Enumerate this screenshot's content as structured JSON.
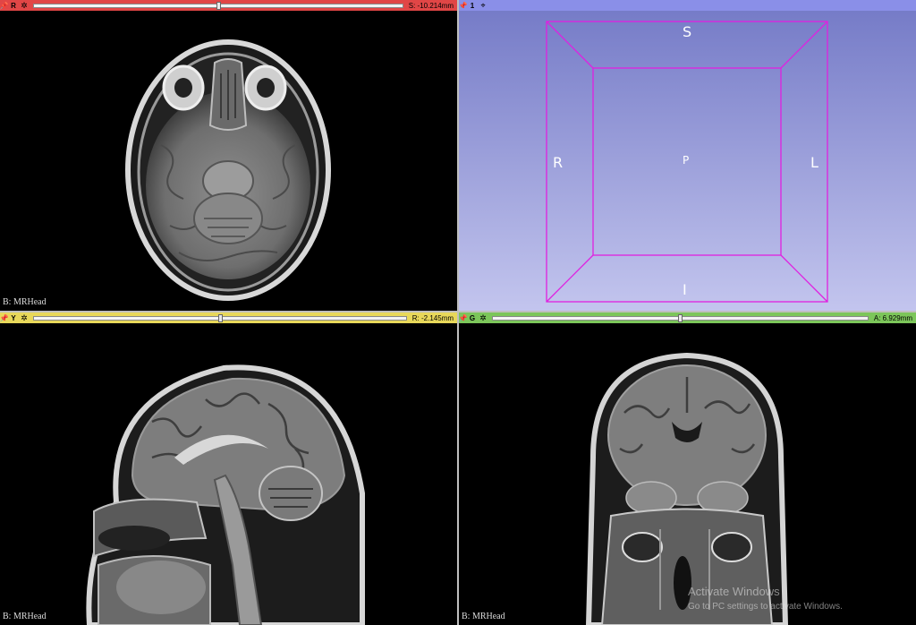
{
  "views": {
    "red": {
      "label": "R",
      "offset_readout": "S: -10.214mm",
      "slice_position": 0.5,
      "volume_label": "B: MRHead",
      "bar_color": "#e14646",
      "icons": [
        "pin-icon",
        "gear-icon"
      ]
    },
    "three_d": {
      "label": "1",
      "bar_color": "#8a8fe8",
      "orientation": {
        "top": "S",
        "bottom": "I",
        "left": "R",
        "right": "L",
        "center": "P"
      },
      "box_color": "#e020e0",
      "icons": [
        "pin-icon",
        "eye-icon"
      ]
    },
    "yellow": {
      "label": "Y",
      "offset_readout": "R: -2.145mm",
      "slice_position": 0.5,
      "volume_label": "B: MRHead",
      "bar_color": "#e8d85a",
      "icons": [
        "pin-icon",
        "gear-icon"
      ]
    },
    "green": {
      "label": "G",
      "offset_readout": "A: 6.929mm",
      "slice_position": 0.5,
      "volume_label": "B: MRHead",
      "bar_color": "#7cc65a",
      "icons": [
        "pin-icon",
        "gear-icon"
      ]
    }
  },
  "watermark": {
    "line1": "Activate Windows",
    "line2": "Go to PC settings to activate Windows."
  }
}
